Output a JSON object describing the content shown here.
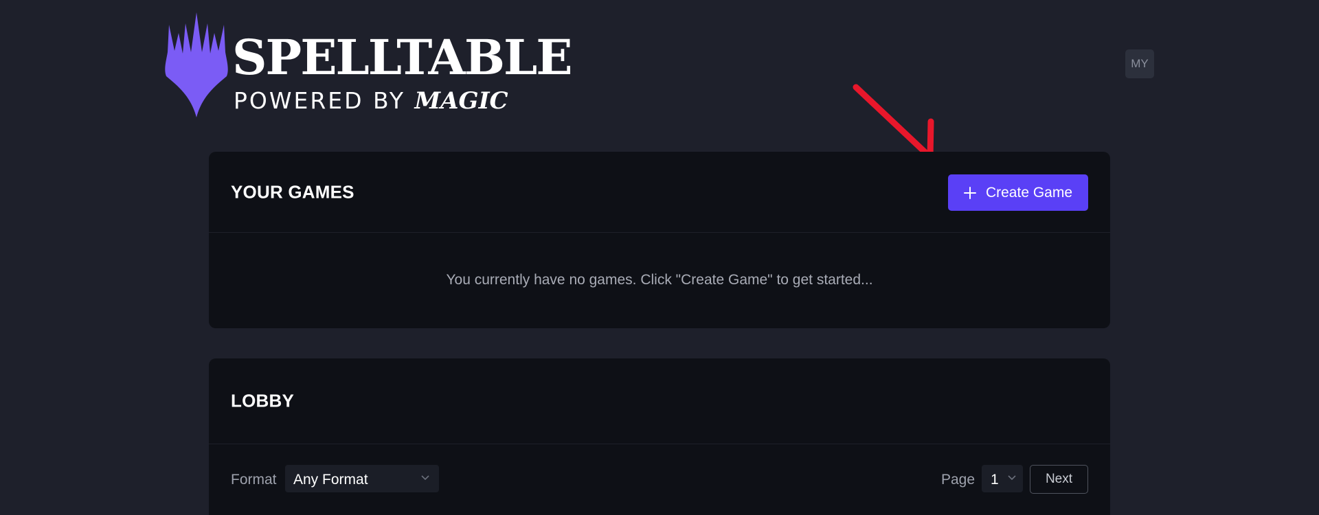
{
  "logo": {
    "title": "SPELLTABLE",
    "subtitle_prefix": "POWERED BY",
    "subtitle_brand": "MAGIC",
    "brand_color": "#7b5cf5"
  },
  "user": {
    "initials": "MY"
  },
  "your_games": {
    "title": "YOUR GAMES",
    "create_button_label": "Create Game",
    "empty_message": "You currently have no games. Click \"Create Game\" to get started..."
  },
  "lobby": {
    "title": "LOBBY",
    "format_label": "Format",
    "format_value": "Any Format",
    "page_label": "Page",
    "page_value": "1",
    "next_label": "Next"
  },
  "colors": {
    "background": "#1e202b",
    "panel": "#0e1016",
    "accent": "#5a40f6",
    "annotation_arrow": "#e8172b"
  }
}
